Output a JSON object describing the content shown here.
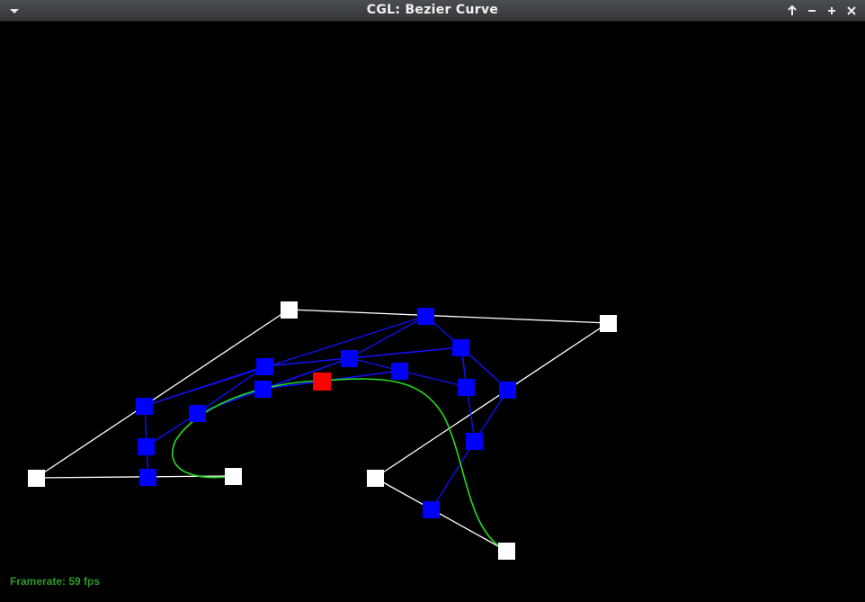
{
  "window": {
    "title": "CGL: Bezier Curve",
    "buttons": [
      "menu-icon",
      "maximize-up-arrow-icon",
      "minimize-icon",
      "expand-plus-icon",
      "close-icon"
    ]
  },
  "status": {
    "framerate": "Framerate: 59 fps"
  },
  "colors": {
    "background": "#000000",
    "control_polygon": "#ffffff",
    "intermediate": "#0000ff",
    "evaluated_point": "#ff0000",
    "curve": "#22dd22",
    "framerate_text": "#2a9a2a"
  }
}
